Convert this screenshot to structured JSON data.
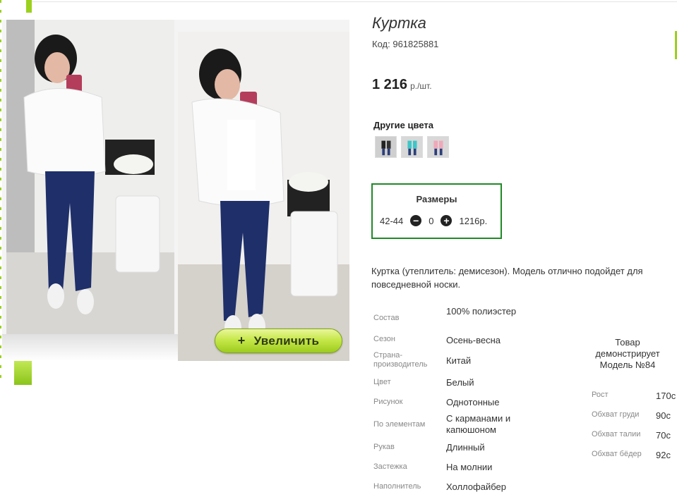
{
  "product": {
    "title": "Куртка",
    "code_label": "Код:",
    "code": "961825881",
    "price": "1 216",
    "price_unit": "р./шт."
  },
  "gallery": {
    "zoom_label": "Увеличить",
    "zoom_icon": "plus-icon"
  },
  "other_colors": {
    "label": "Другие цвета",
    "swatches": [
      "black",
      "turquoise",
      "pink"
    ]
  },
  "sizes": {
    "title": "Размеры",
    "rows": [
      {
        "size": "42-44",
        "quantity": "0",
        "price": "1216р."
      }
    ]
  },
  "description": "Куртка (утеплитель: демисезон). Модель отлично подойдет для повседневной носки.",
  "specs": [
    {
      "label": "Состав",
      "value": "100% полиэстер"
    },
    {
      "label": "Сезон",
      "value": "Осень-весна"
    },
    {
      "label": "Страна-производитель",
      "value": "Китай"
    },
    {
      "label": "Цвет",
      "value": "Белый"
    },
    {
      "label": "Рисунок",
      "value": "Однотонные"
    },
    {
      "label": "По элементам",
      "value": "С карманами и капюшоном"
    },
    {
      "label": "Рукав",
      "value": "Длинный"
    },
    {
      "label": "Застежка",
      "value": "На молнии"
    },
    {
      "label": "Наполнитель",
      "value": "Холлофайбер"
    }
  ],
  "model": {
    "title": "Товар демонстрирует Модель №84",
    "params": [
      {
        "label": "Рост",
        "value": "170с"
      },
      {
        "label": "Обхват груди",
        "value": "90с"
      },
      {
        "label": "Обхват талии",
        "value": "70с"
      },
      {
        "label": "Обхват бёдер",
        "value": "92с"
      }
    ]
  },
  "colors": {
    "accent_green": "#9bd11e",
    "size_box_border": "#1f8a26",
    "button_gradient_top": "#e9f79a",
    "button_gradient_bottom": "#9dcc1e"
  }
}
